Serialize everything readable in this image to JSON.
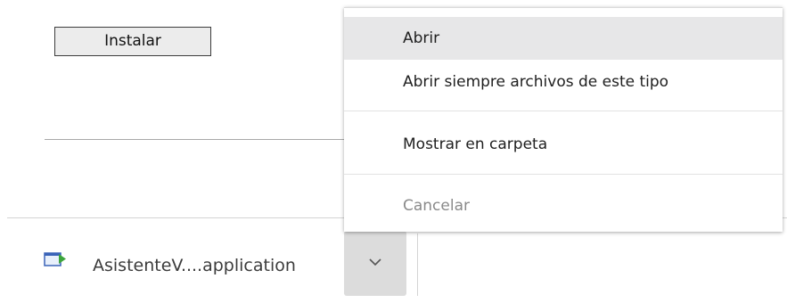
{
  "page": {
    "install_button_label": "Instalar"
  },
  "downloads": {
    "file_name": "AsistenteV....application",
    "file_icon": "application-file-icon",
    "chevron_icon": "chevron-down-icon"
  },
  "context_menu": {
    "items": [
      {
        "label": "Abrir",
        "state": "highlighted"
      },
      {
        "label": "Abrir siempre archivos de este tipo",
        "state": "normal"
      },
      {
        "label": "Mostrar en carpeta",
        "state": "normal"
      },
      {
        "label": "Cancelar",
        "state": "disabled"
      }
    ]
  },
  "colors": {
    "highlight": "#e7e7e8",
    "disabled_text": "#8a8a8a",
    "chevron_button_bg": "#dcdcdc"
  }
}
